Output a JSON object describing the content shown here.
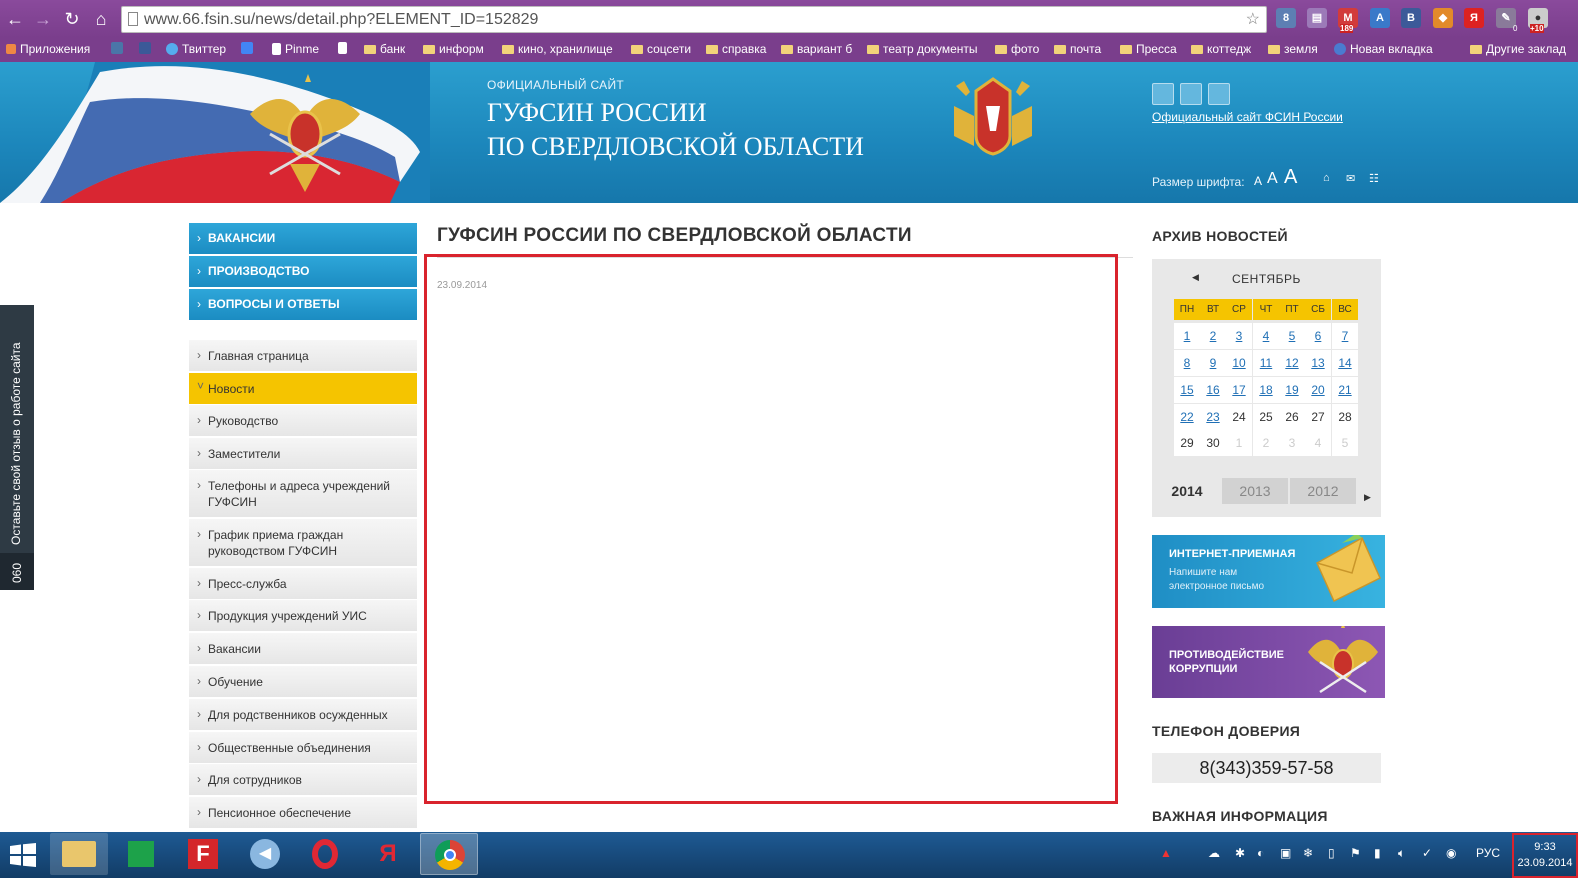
{
  "browser": {
    "url": "www.66.fsin.su/news/detail.php?ELEMENT_ID=152829",
    "bookmarks": [
      "Приложения",
      "Твиттер",
      "Pinme",
      "банк",
      "информ",
      "кино, хранилище",
      "соцсети",
      "справка",
      "вариант б",
      "театр документы",
      "фото",
      "почта",
      "Пресса",
      "коттедж",
      "земля",
      "Новая вкладка",
      "Другие заклад"
    ],
    "ext_badges": {
      "mail": "189",
      "extra": "+10",
      "counter": "0"
    }
  },
  "header": {
    "small_title": "ОФИЦИАЛЬНЫЙ САЙТ",
    "title_line1": "ГУФСИН РОССИИ",
    "title_line2": "ПО СВЕРДЛОВСКОЙ ОБЛАСТИ",
    "fsin_link": "Официальный сайт ФСИН России",
    "font_size_label": "Размер шрифта:",
    "font_sizes": [
      "A",
      "A",
      "A"
    ]
  },
  "feedback": {
    "label": "Оставьте свой отзыв о работе сайта",
    "code": "060"
  },
  "top_menu": [
    "ВАКАНСИИ",
    "ПРОИЗВОДСТВО",
    "ВОПРОСЫ И ОТВЕТЫ"
  ],
  "side_menu": [
    "Главная страница",
    "Новости",
    "Руководство",
    "Заместители",
    "Телефоны и адреса учреждений ГУФСИН",
    "График приема граждан руководством ГУФСИН",
    "Пресс-служба",
    "Продукция учреждений УИС",
    "Вакансии",
    "Обучение",
    "Для родственников осужденных",
    "Общественные объединения",
    "Для сотрудников",
    "Пенсионное обеспечение"
  ],
  "main": {
    "title": "ГУФСИН РОССИИ ПО СВЕРДЛОВСКОЙ ОБЛАСТИ",
    "date": "23.09.2014"
  },
  "archive": {
    "heading": "АРХИВ НОВОСТЕЙ",
    "month": "СЕНТЯБРЬ",
    "weekdays": [
      "ПН",
      "ВТ",
      "СР",
      "ЧТ",
      "ПТ",
      "СБ",
      "ВС"
    ],
    "weeks": [
      [
        "1",
        "2",
        "3",
        "4",
        "5",
        "6",
        "7"
      ],
      [
        "8",
        "9",
        "10",
        "11",
        "12",
        "13",
        "14"
      ],
      [
        "15",
        "16",
        "17",
        "18",
        "19",
        "20",
        "21"
      ],
      [
        "22",
        "23",
        "24",
        "25",
        "26",
        "27",
        "28"
      ],
      [
        "29",
        "30",
        "1",
        "2",
        "3",
        "4",
        "5"
      ]
    ],
    "years": [
      "2014",
      "2013",
      "2012"
    ]
  },
  "banners": {
    "internet_title": "ИНТЕРНЕТ-ПРИЕМНАЯ",
    "internet_sub": "Напишите нам электронное письмо",
    "corruption_title": "ПРОТИВОДЕЙСТВИЕ КОРРУПЦИИ"
  },
  "phone": {
    "heading": "ТЕЛЕФОН ДОВЕРИЯ",
    "number": "8(343)359-57-58"
  },
  "important": {
    "heading": "ВАЖНАЯ ИНФОРМАЦИЯ"
  },
  "taskbar": {
    "lang": "РУС",
    "time": "9:33",
    "date": "23.09.2014"
  }
}
